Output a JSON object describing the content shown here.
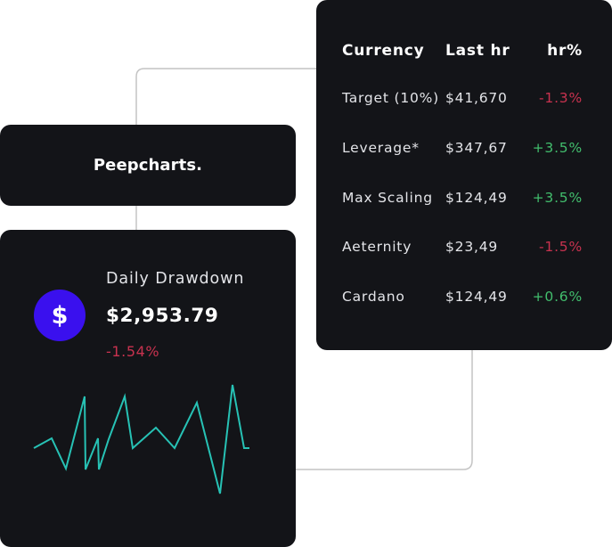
{
  "brand": {
    "name": "Peepcharts."
  },
  "currency_table": {
    "headers": {
      "currency": "Currency",
      "last_hr": "Last hr",
      "hr_pct": "hr%"
    },
    "rows": [
      {
        "name": "Target (10%)",
        "value": "$41,670",
        "change": "-1.3%",
        "direction": "down"
      },
      {
        "name": "Leverage*",
        "value": "$347,67",
        "change": "+3.5%",
        "direction": "up"
      },
      {
        "name": "Max Scaling",
        "value": "$124,49",
        "change": "+3.5%",
        "direction": "up"
      },
      {
        "name": "Aeternity",
        "value": "$23,49",
        "change": "-1.5%",
        "direction": "down"
      },
      {
        "name": "Cardano",
        "value": "$124,49",
        "change": "+0.6%",
        "direction": "up"
      }
    ]
  },
  "drawdown": {
    "icon": "dollar-icon",
    "icon_glyph": "$",
    "title": "Daily Drawdown",
    "value": "$2,953.79",
    "change": "-1.54%",
    "sparkline": [
      0.13,
      0.24,
      -0.1,
      0.71,
      -0.11,
      0.24,
      -0.11,
      0.23,
      0.71,
      0.13,
      0.36,
      0.13,
      0.64,
      -0.38,
      0.84,
      0.13,
      0.13
    ]
  },
  "colors": {
    "card_bg": "#131418",
    "accent": "#3a10ee",
    "positive": "#42be6d",
    "negative": "#c8324f",
    "sparkline": "#27c2b5",
    "connector": "#c4c4c4"
  }
}
